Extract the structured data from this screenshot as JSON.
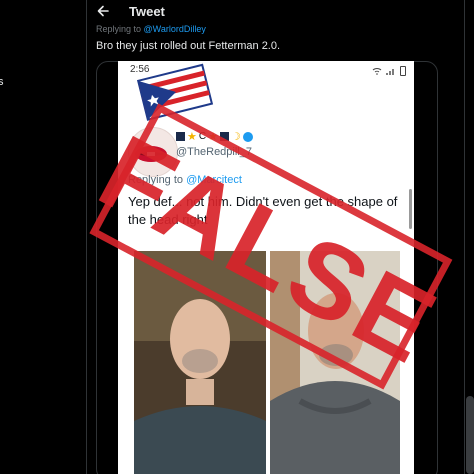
{
  "left_nav": {
    "fragment": "s"
  },
  "header": {
    "title": "Tweet"
  },
  "tweet": {
    "replying_label": "Replying to",
    "replying_handle": "@WarlordDilley",
    "text": "Bro they just rolled out Fetterman 2.0."
  },
  "screenshot": {
    "status_time": "2:56",
    "user_name_symbols": "C",
    "handle": "@TheRedpill_7",
    "replying_label": "Replying to",
    "replying_handle": "@Marcitect",
    "text": "Yep def... not him. Didn't even get the shape of the head right"
  },
  "stamp": {
    "text": "FALSE",
    "color": "#d8232a"
  },
  "colors": {
    "accent": "#1d9bf0",
    "background": "#000000"
  }
}
